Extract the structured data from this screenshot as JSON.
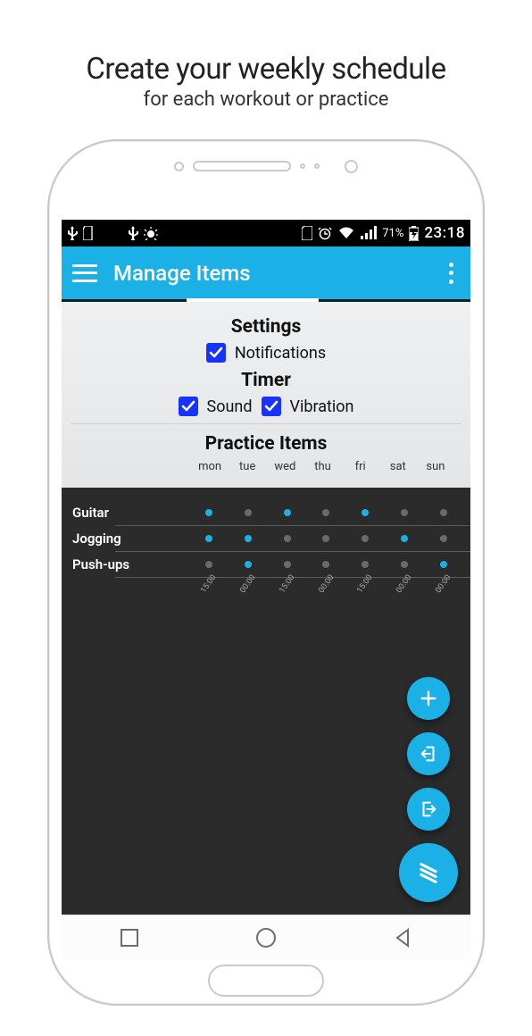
{
  "promo": {
    "title": "Create your weekly schedule",
    "subtitle": "for each workout or practice"
  },
  "status": {
    "battery_pct": "71%",
    "time": "23:18"
  },
  "appbar": {
    "title": "Manage Items"
  },
  "settings": {
    "heading": "Settings",
    "notifications_label": "Notifications",
    "notifications_checked": true,
    "timer_heading": "Timer",
    "sound_label": "Sound",
    "sound_checked": true,
    "vibration_label": "Vibration",
    "vibration_checked": true
  },
  "schedule": {
    "heading": "Practice Items",
    "days": [
      "mon",
      "tue",
      "wed",
      "thu",
      "fri",
      "sat",
      "sun"
    ],
    "items": [
      {
        "name": "Guitar",
        "days_on": [
          true,
          false,
          true,
          false,
          true,
          false,
          false
        ],
        "times": [
          "",
          "",
          "",
          "",
          "",
          "",
          ""
        ]
      },
      {
        "name": "Jogging",
        "days_on": [
          true,
          true,
          false,
          false,
          false,
          true,
          false
        ],
        "times": [
          "",
          "",
          "",
          "",
          "",
          "",
          ""
        ]
      },
      {
        "name": "Push-ups",
        "days_on": [
          false,
          true,
          false,
          false,
          false,
          false,
          true
        ],
        "times": [
          "15:00",
          "00:00",
          "15:00",
          "00:00",
          "15:00",
          "00:00",
          "00:00"
        ]
      }
    ]
  },
  "colors": {
    "accent": "#1cb1e6",
    "checkbox": "#1733ff",
    "dark_pane": "#2b2b2b"
  }
}
